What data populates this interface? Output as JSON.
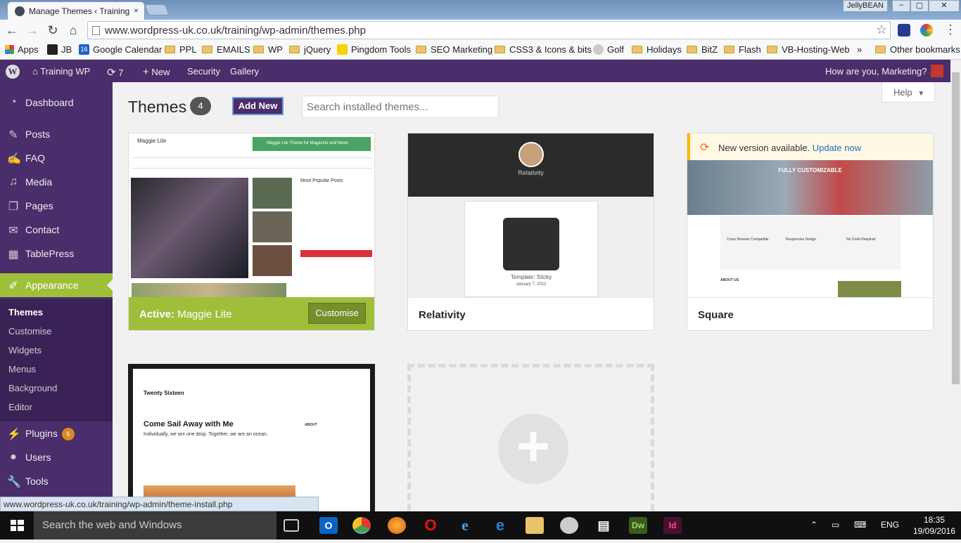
{
  "browser": {
    "tab_title": "Manage Themes ‹ Training",
    "tab_close": "×",
    "profile_name": "JellyBEAN",
    "url": "www.wordpress-uk.co.uk/training/wp-admin/themes.php",
    "bookmarks": [
      "Apps",
      "JB",
      "Google Calendar",
      "PPL",
      "EMAILS",
      "WP",
      "jQuery",
      "Pingdom Tools",
      "SEO Marketing",
      "CSS3 & Icons & bits",
      "Golf",
      "Holidays",
      "BitZ",
      "Flash",
      "VB-Hosting-Web"
    ],
    "bookmarks_overflow": "»",
    "other_bookmarks": "Other bookmarks",
    "calendar_badge": "16",
    "status_url": "www.wordpress-uk.co.uk/training/wp-admin/theme-install.php"
  },
  "adminbar": {
    "site_name": "Training WP",
    "updates_count": "7",
    "new_label": "New",
    "security_label": "Security",
    "gallery_label": "Gallery",
    "greeting": "How are you, Marketing?"
  },
  "sidebar": {
    "items": [
      {
        "label": "Dashboard",
        "icon": "dashboard-icon"
      },
      {
        "label": "Posts",
        "icon": "pin-icon"
      },
      {
        "label": "FAQ",
        "icon": "edit-icon"
      },
      {
        "label": "Media",
        "icon": "media-icon"
      },
      {
        "label": "Pages",
        "icon": "pages-icon"
      },
      {
        "label": "Contact",
        "icon": "mail-icon"
      },
      {
        "label": "TablePress",
        "icon": "table-icon"
      },
      {
        "label": "Appearance",
        "icon": "brush-icon"
      }
    ],
    "submenu": [
      "Themes",
      "Customise",
      "Widgets",
      "Menus",
      "Background",
      "Editor"
    ],
    "plugins_label": "Plugins",
    "plugins_badge": "6",
    "users_label": "Users",
    "tools_label": "Tools"
  },
  "page": {
    "title": "Themes",
    "theme_count": "4",
    "add_new": "Add New",
    "search_placeholder": "Search installed themes...",
    "help": "Help"
  },
  "themes": [
    {
      "name": "Maggie Lite",
      "active_prefix": "Active:",
      "action": "Customise"
    },
    {
      "name": "Relativity"
    },
    {
      "name": "Square",
      "update_text": "New version available.",
      "update_link": "Update now"
    },
    {
      "name": "Twenty Sixteen"
    }
  ],
  "screenshots": {
    "maggie": {
      "site_title": "Maggie Lite",
      "banner": "Maggie Lite Theme for Magazine and News",
      "sidebar_heading": "Most Popular Posts"
    },
    "relativity": {
      "site_title": "Relativity",
      "post_title": "Template: Sticky",
      "post_date": "January 7, 2012"
    },
    "square": {
      "hero": "FULLY CUSTOMIZABLE",
      "feature1": "Cross Browser Compatible",
      "feature2": "Responsive Design",
      "feature3": "No Code Required",
      "about": "ABOUT US"
    },
    "twentysixteen": {
      "site_title": "Twenty Sixteen",
      "post_title": "Come Sail Away with Me",
      "intro": "Individually, we are one drop. Together, we are an ocean.",
      "about": "ABOUT"
    }
  },
  "taskbar": {
    "search_placeholder": "Search the web and Windows",
    "lang": "ENG",
    "time": "18:35",
    "date": "19/09/2016"
  }
}
